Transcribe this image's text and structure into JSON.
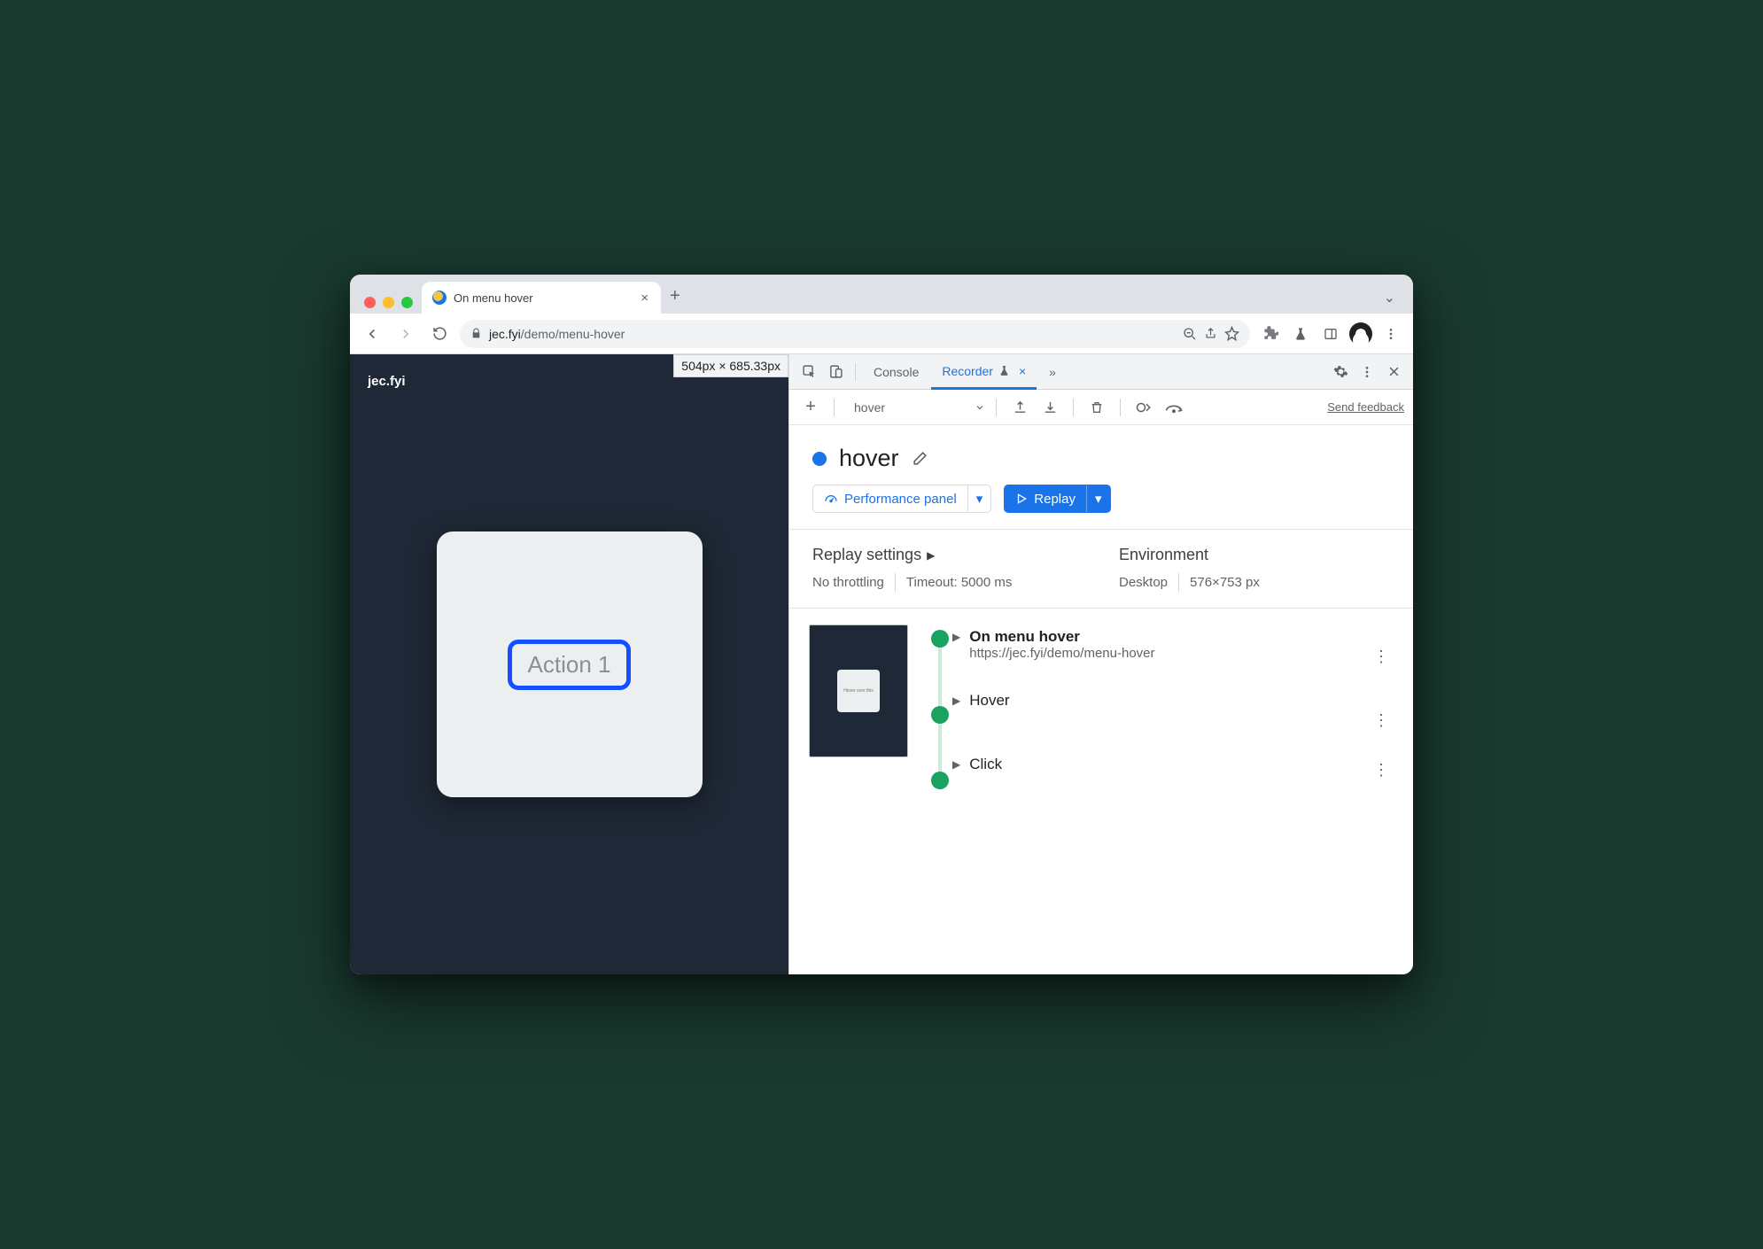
{
  "tab": {
    "title": "On menu hover",
    "close": "×",
    "newtab": "+",
    "overflow_chevron": "⌄"
  },
  "url": {
    "host": "jec.fyi",
    "path": "/demo/menu-hover"
  },
  "page": {
    "brand": "jec.fyi",
    "tooltip": "504px × 685.33px",
    "action_label": "Action 1"
  },
  "devtools": {
    "tabs": {
      "console": "Console",
      "recorder": "Recorder",
      "more": "»"
    },
    "toolbar": {
      "add": "+",
      "recording_name": "hover",
      "feedback": "Send feedback"
    },
    "title": "hover",
    "actions": {
      "perf": "Performance panel",
      "replay": "Replay"
    },
    "settings": {
      "replay_heading": "Replay settings",
      "throttling": "No throttling",
      "timeout": "Timeout: 5000 ms",
      "env_heading": "Environment",
      "device": "Desktop",
      "viewport": "576×753 px"
    },
    "steps": [
      {
        "title": "On menu hover",
        "subtitle": "https://jec.fyi/demo/menu-hover"
      },
      {
        "title": "Hover"
      },
      {
        "title": "Click"
      }
    ]
  }
}
